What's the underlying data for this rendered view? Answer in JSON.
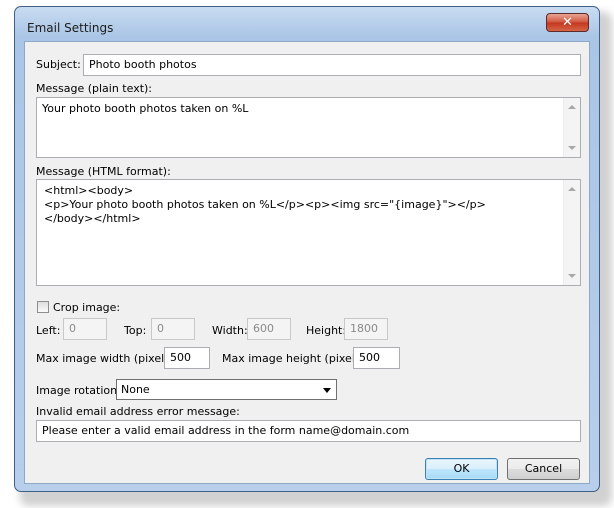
{
  "window": {
    "title": "Email Settings",
    "close_symbol": "✕"
  },
  "subject": {
    "label": "Subject:",
    "value": "Photo booth photos"
  },
  "message_plain": {
    "label": "Message (plain text):",
    "value": "Your photo booth photos taken on %L"
  },
  "message_html": {
    "label": "Message (HTML format):",
    "value": "<html><body>\n<p>Your photo booth photos taken on %L</p><p><img src=\"{image}\"></p>\n</body></html>"
  },
  "crop": {
    "label": "Crop image:",
    "checked": false,
    "left": {
      "label": "Left:",
      "value": "0"
    },
    "top": {
      "label": "Top:",
      "value": "0"
    },
    "width": {
      "label": "Width:",
      "value": "600"
    },
    "height": {
      "label": "Height:",
      "value": "1800"
    }
  },
  "max_width": {
    "label": "Max image width (pixels):",
    "value": "500"
  },
  "max_height": {
    "label": "Max image height (pixels):",
    "value": "500"
  },
  "rotation": {
    "label": "Image rotation:",
    "value": "None"
  },
  "invalid_email": {
    "label": "Invalid email address error message:",
    "value": "Please enter a valid email address in the form name@domain.com"
  },
  "buttons": {
    "ok": "OK",
    "cancel": "Cancel"
  },
  "icons": {
    "close": "close-icon",
    "scroll_up": "scroll-up-arrow-icon",
    "scroll_down": "scroll-down-arrow-icon",
    "dropdown": "chevron-down-icon"
  },
  "colors": {
    "titlebar": "#aac5e6",
    "close_button": "#c2361d",
    "client": "#f0f0f0"
  }
}
